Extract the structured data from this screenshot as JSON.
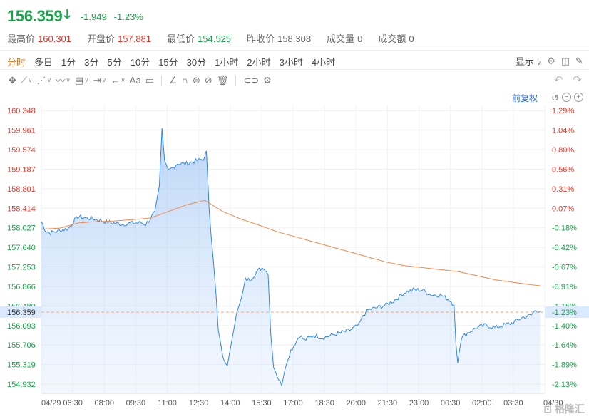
{
  "quote": {
    "price": "156.359",
    "change": "-1.949",
    "change_pct": "-1.23%"
  },
  "stats": [
    {
      "label": "最高价",
      "value": "160.301",
      "color": "red"
    },
    {
      "label": "开盘价",
      "value": "157.881",
      "color": "red"
    },
    {
      "label": "最低价",
      "value": "154.525",
      "color": "green"
    },
    {
      "label": "昨收价",
      "value": "158.308",
      "color": "none"
    },
    {
      "label": "成交量",
      "value": "0",
      "color": "none"
    },
    {
      "label": "成交额",
      "value": "0",
      "color": "none"
    }
  ],
  "tabs": [
    "分时",
    "多日",
    "1分",
    "3分",
    "5分",
    "10分",
    "15分",
    "30分",
    "1小时",
    "2小时",
    "3小时",
    "4小时"
  ],
  "active_tab": "分时",
  "display_label": "显示",
  "fuquan_label": "前复权",
  "toolbar_icons": [
    "crosshair-icon",
    "line-icon",
    "polyline-icon",
    "wave-icon",
    "fib-icon",
    "measure-icon",
    "arrow-icon",
    "text-icon",
    "comment-icon",
    "ruler-icon",
    "magnet-icon",
    "lock-icon",
    "hide-icon",
    "trash-icon",
    "link-icon",
    "settings-icon"
  ],
  "watermark": "格隆汇",
  "colors": {
    "accent": "#e87b1e",
    "price_line": "#2e86e8",
    "avg_line": "#f08a4b",
    "up": "#e5362a",
    "down": "#1aa34a",
    "ref_line": "#f4a77a"
  },
  "chart_data": {
    "type": "line",
    "x_ticks": [
      "04/29",
      "06:30",
      "08:00",
      "09:30",
      "11:00",
      "12:30",
      "14:00",
      "15:30",
      "17:00",
      "18:30",
      "20:00",
      "21:30",
      "23:00",
      "00:30",
      "02:00",
      "03:30",
      "04/30"
    ],
    "y_ticks_left": [
      "160.348",
      "159.961",
      "159.574",
      "159.187",
      "158.801",
      "158.414",
      "158.027",
      "157.640",
      "157.253",
      "156.866",
      "156.480",
      "156.093",
      "155.706",
      "155.319",
      "154.932"
    ],
    "y_ticks_right": [
      "1.29%",
      "1.04%",
      "0.80%",
      "0.56%",
      "0.31%",
      "0.07%",
      "-0.18%",
      "-0.42%",
      "-0.67%",
      "-0.91%",
      "-1.15%",
      "-1.40%",
      "-1.64%",
      "-1.89%",
      "-2.13%"
    ],
    "ylim": [
      154.75,
      160.45
    ],
    "prev_close": 158.308,
    "current_price_label": "156.359",
    "current_pct_label": "-1.23%",
    "series": [
      {
        "values": [
          [
            0,
            158.15
          ],
          [
            0.5,
            157.96
          ],
          [
            1,
            157.93
          ],
          [
            2,
            157.97
          ],
          [
            3,
            158.02
          ],
          [
            4,
            158.25
          ],
          [
            5,
            158.22
          ],
          [
            6,
            158.2
          ],
          [
            7,
            158.15
          ],
          [
            8,
            158.12
          ],
          [
            9,
            158.1
          ],
          [
            10,
            158.12
          ],
          [
            11,
            158.13
          ],
          [
            11.5,
            158.1
          ],
          [
            12,
            158.2
          ],
          [
            12.5,
            158.35
          ],
          [
            13,
            158.85
          ],
          [
            13.3,
            160.0
          ],
          [
            13.6,
            159.3
          ],
          [
            14,
            159.15
          ],
          [
            15,
            159.3
          ],
          [
            16,
            159.3
          ],
          [
            17,
            159.35
          ],
          [
            18,
            159.4
          ],
          [
            18.2,
            159.55
          ],
          [
            18.5,
            158.4
          ],
          [
            18.7,
            157.9
          ],
          [
            19,
            157.3
          ],
          [
            19.3,
            156.6
          ],
          [
            19.5,
            156.0
          ],
          [
            20,
            155.5
          ],
          [
            20.5,
            155.3
          ],
          [
            21,
            155.8
          ],
          [
            21.5,
            156.3
          ],
          [
            22,
            156.6
          ],
          [
            22.5,
            157.0
          ],
          [
            23,
            157.0
          ],
          [
            23.5,
            157.1
          ],
          [
            24,
            157.2
          ],
          [
            24.5,
            157.25
          ],
          [
            25,
            157.1
          ],
          [
            25.3,
            155.9
          ],
          [
            25.6,
            155.3
          ],
          [
            26,
            155.1
          ],
          [
            26.5,
            154.9
          ],
          [
            27,
            155.35
          ],
          [
            27.5,
            155.6
          ],
          [
            28,
            155.75
          ],
          [
            28.5,
            155.9
          ],
          [
            29,
            155.8
          ],
          [
            30,
            155.9
          ],
          [
            31,
            155.85
          ],
          [
            32,
            155.9
          ],
          [
            33,
            155.95
          ],
          [
            34,
            156.0
          ],
          [
            35,
            156.1
          ],
          [
            35.5,
            156.3
          ],
          [
            36,
            156.4
          ],
          [
            37,
            156.45
          ],
          [
            38,
            156.5
          ],
          [
            39,
            156.6
          ],
          [
            40,
            156.75
          ],
          [
            41,
            156.8
          ],
          [
            42,
            156.8
          ],
          [
            43,
            156.7
          ],
          [
            44,
            156.7
          ],
          [
            45,
            156.6
          ],
          [
            45.5,
            156.5
          ],
          [
            45.7,
            155.75
          ],
          [
            45.9,
            155.35
          ],
          [
            46.3,
            155.85
          ],
          [
            47,
            155.95
          ],
          [
            48,
            156.05
          ],
          [
            49,
            156.1
          ],
          [
            50,
            156.05
          ],
          [
            51,
            156.1
          ],
          [
            52,
            156.15
          ],
          [
            53,
            156.25
          ],
          [
            54,
            156.3
          ],
          [
            54.5,
            156.4
          ],
          [
            55,
            156.38
          ]
        ]
      },
      {
        "values": [
          [
            0,
            158.0
          ],
          [
            2,
            158.02
          ],
          [
            4,
            158.12
          ],
          [
            6,
            158.15
          ],
          [
            8,
            158.16
          ],
          [
            10,
            158.19
          ],
          [
            12,
            158.22
          ],
          [
            14,
            158.35
          ],
          [
            16,
            158.48
          ],
          [
            18,
            158.57
          ],
          [
            20,
            158.35
          ],
          [
            22,
            158.2
          ],
          [
            24,
            158.08
          ],
          [
            26,
            157.95
          ],
          [
            28,
            157.85
          ],
          [
            30,
            157.75
          ],
          [
            32,
            157.65
          ],
          [
            34,
            157.55
          ],
          [
            36,
            157.45
          ],
          [
            38,
            157.35
          ],
          [
            40,
            157.28
          ],
          [
            42,
            157.24
          ],
          [
            44,
            157.2
          ],
          [
            46,
            157.16
          ],
          [
            48,
            157.08
          ],
          [
            50,
            157.0
          ],
          [
            52,
            156.95
          ],
          [
            54,
            156.9
          ],
          [
            55,
            156.88
          ]
        ]
      }
    ]
  }
}
